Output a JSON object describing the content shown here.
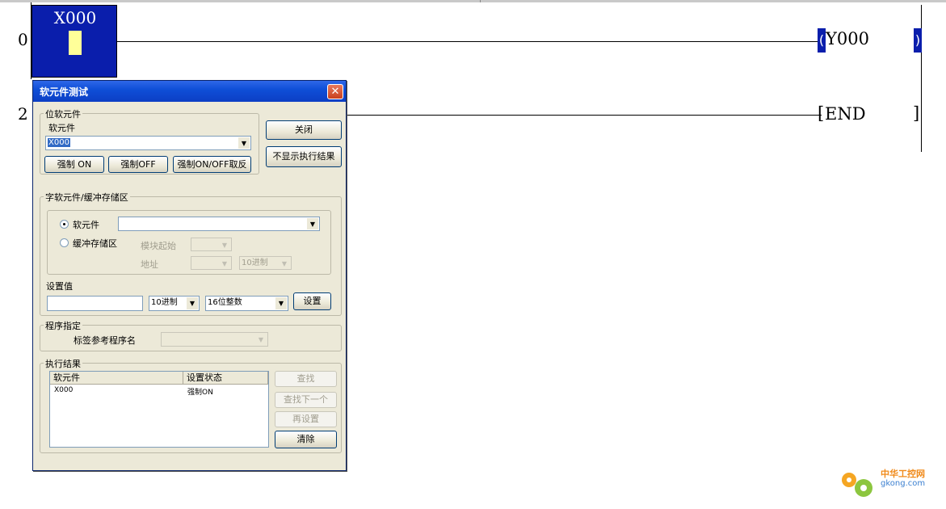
{
  "ladder": {
    "rung0": "0",
    "rung2": "2",
    "contact_label": "X000",
    "coil_label": "Y000",
    "end_label": "END",
    "coil_open": "(",
    "coil_close": ")",
    "end_open": "[",
    "end_close": "]"
  },
  "dialog": {
    "title": "软元件测试",
    "close_glyph": "✕",
    "bit_group": {
      "title": "位软元件",
      "device_label": "软元件",
      "device_value": "X000",
      "force_on": "强制 ON",
      "force_off": "强制OFF",
      "force_toggle": "强制ON/OFF取反"
    },
    "close_button": "关闭",
    "hide_results_button": "不显示执行结果",
    "word_group": {
      "title": "字软元件/缓冲存储区",
      "radio_device": "软元件",
      "radio_buffer": "缓冲存储区",
      "module_start": "模块起始",
      "address": "地址",
      "radix_disabled": "10进制"
    },
    "set_value": {
      "label": "设置值",
      "input_value": "",
      "radix": "10进制",
      "datatype": "16位整数",
      "set_button": "设置"
    },
    "program_group": {
      "title": "程序指定",
      "label_ref": "标签参考程序名"
    },
    "result_group": {
      "title": "执行结果",
      "col_device": "软元件",
      "col_status": "设置状态",
      "rows": [
        {
          "device": "X000",
          "status": "强制ON"
        }
      ],
      "find": "查找",
      "find_next": "查找下一个",
      "reset": "再设置",
      "clear": "清除"
    }
  },
  "watermark": {
    "name": "中华工控网",
    "url": "gkong.com"
  },
  "colors": {
    "selection_blue": "#0a1eac",
    "contact_fill": "#ffff99",
    "titlebar": "#0f4fd8"
  }
}
